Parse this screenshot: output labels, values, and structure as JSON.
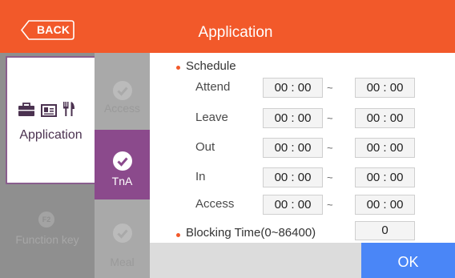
{
  "header": {
    "back_label": "BACK",
    "title": "Application",
    "color": "#f2592a"
  },
  "categories": [
    {
      "label": "Application",
      "icons": [
        "briefcase-icon",
        "id-card-icon",
        "utensils-icon"
      ],
      "selected": true
    },
    {
      "label": "Function key",
      "icon": "f2-key-icon",
      "icon_text": "F2",
      "selected": false
    }
  ],
  "subcategories": [
    {
      "label": "Access",
      "icon": "check-circle-icon",
      "selected": false
    },
    {
      "label": "TnA",
      "icon": "check-circle-icon",
      "selected": true
    },
    {
      "label": "Meal",
      "icon": "check-circle-icon",
      "selected": false
    }
  ],
  "schedule": {
    "title": "Schedule",
    "separator": "~",
    "rows": [
      {
        "label": "Attend",
        "start": "00 : 00",
        "end": "00 : 00"
      },
      {
        "label": "Leave",
        "start": "00 : 00",
        "end": "00 : 00"
      },
      {
        "label": "Out",
        "start": "00 : 00",
        "end": "00 : 00"
      },
      {
        "label": "In",
        "start": "00 : 00",
        "end": "00 : 00"
      },
      {
        "label": "Access",
        "start": "00 : 00",
        "end": "00 : 00"
      }
    ]
  },
  "blocking": {
    "label": "Blocking Time(0~86400)",
    "value": "0"
  },
  "footer": {
    "ok_label": "OK",
    "ok_color": "#4a86f7"
  },
  "colors": {
    "selected_sub": "#8b4a8c",
    "accent_bullet": "#f2592a"
  }
}
